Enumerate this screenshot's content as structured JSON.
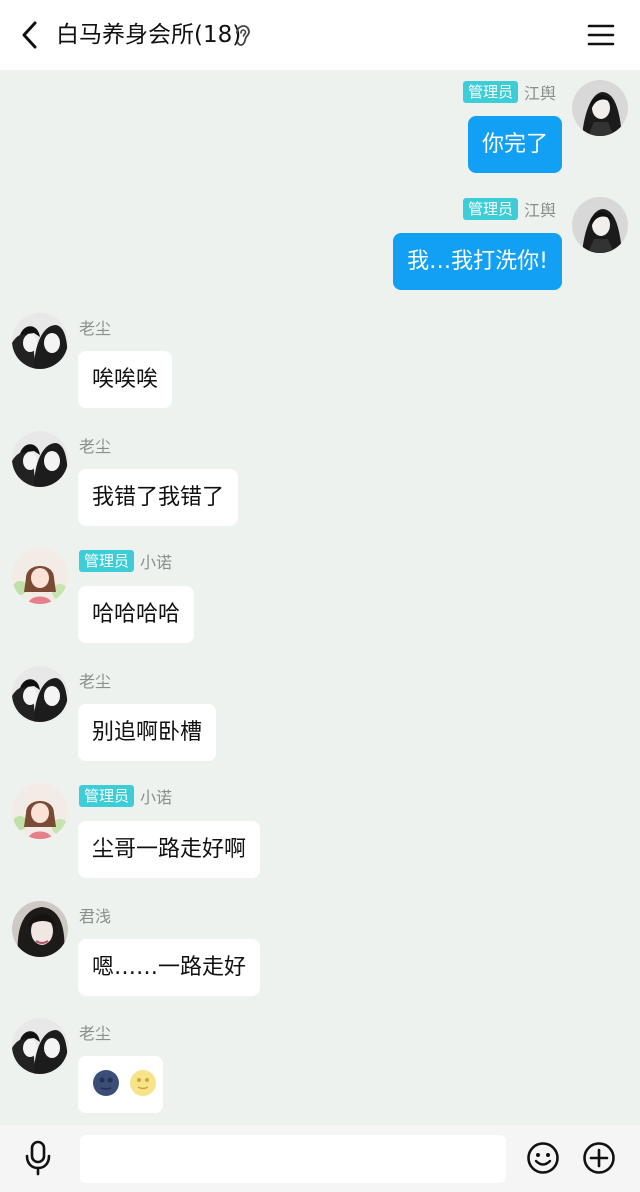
{
  "header": {
    "title": "白马养身会所(18)",
    "back_icon": "chevron-left-icon",
    "ear_icon": "ear-icon",
    "menu_icon": "hamburger-menu-icon"
  },
  "colors": {
    "background": "#eef2ef",
    "outgoing_bubble": "#12a0f5",
    "incoming_bubble": "#ffffff",
    "admin_badge": "#3dcdd7"
  },
  "messages": [
    {
      "side": "out",
      "badge": "管理员",
      "name": "江舆",
      "text": "你完了"
    },
    {
      "side": "out",
      "badge": "管理员",
      "name": "江舆",
      "text": "我…我打洗你!"
    },
    {
      "side": "in",
      "name": "老尘",
      "text": "唉唉唉"
    },
    {
      "side": "in",
      "name": "老尘",
      "text": "我错了我错了"
    },
    {
      "side": "in",
      "badge": "管理员",
      "name": "小诺",
      "text": "哈哈哈哈"
    },
    {
      "side": "in",
      "name": "老尘",
      "text": "别追啊卧槽"
    },
    {
      "side": "in",
      "badge": "管理员",
      "name": "小诺",
      "text": "尘哥一路走好啊"
    },
    {
      "side": "in",
      "name": "君浅",
      "text": "嗯……一路走好"
    },
    {
      "side": "in",
      "name": "老尘",
      "emojis": [
        "new-moon-face-emoji",
        "full-moon-face-emoji"
      ]
    }
  ],
  "input_bar": {
    "placeholder": "",
    "mic_icon": "microphone-icon",
    "emoji_icon": "smiley-icon",
    "plus_icon": "plus-circle-icon"
  }
}
